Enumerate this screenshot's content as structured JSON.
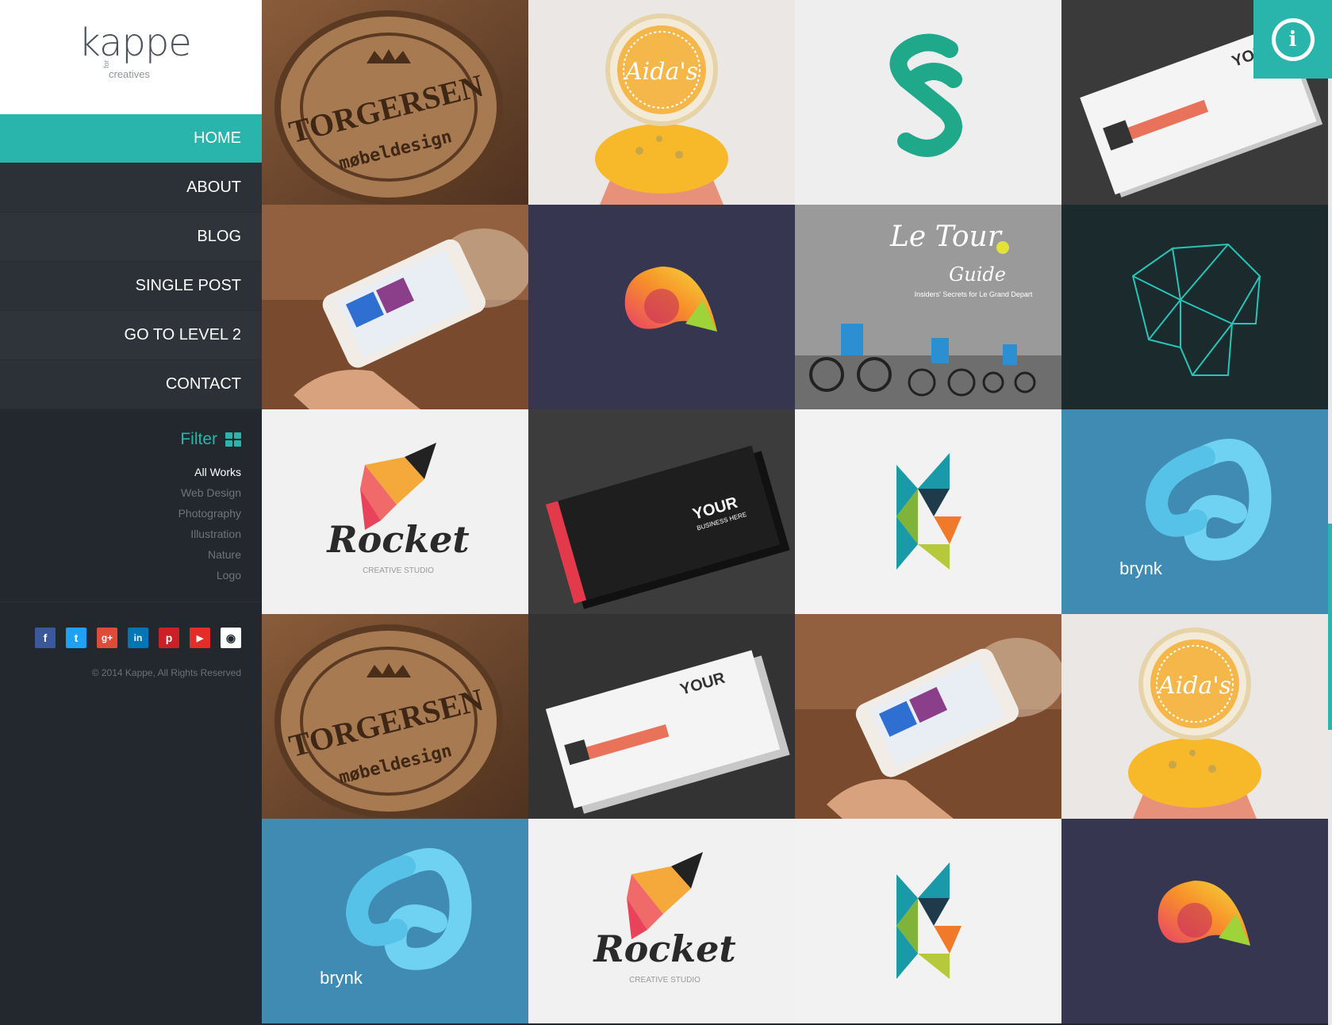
{
  "brand": {
    "logo_main": "kappe",
    "logo_for": "for",
    "logo_sub": "creatives"
  },
  "nav": {
    "items": [
      {
        "label": "HOME",
        "active": true
      },
      {
        "label": "ABOUT",
        "active": false
      },
      {
        "label": "BLOG",
        "active": false
      },
      {
        "label": "SINGLE POST",
        "active": false
      },
      {
        "label": "GO TO LEVEL 2",
        "active": false
      },
      {
        "label": "CONTACT",
        "active": false
      }
    ]
  },
  "filter": {
    "title": "Filter",
    "icon": "grid-icon",
    "options": [
      {
        "label": "All Works",
        "active": true
      },
      {
        "label": "Web Design",
        "active": false
      },
      {
        "label": "Photography",
        "active": false
      },
      {
        "label": "Illustration",
        "active": false
      },
      {
        "label": "Nature",
        "active": false
      },
      {
        "label": "Logo",
        "active": false
      }
    ]
  },
  "social": [
    {
      "name": "facebook-icon",
      "glyph": "f",
      "color": "#3b5998"
    },
    {
      "name": "twitter-icon",
      "glyph": "t",
      "color": "#1da1f2"
    },
    {
      "name": "google-plus-icon",
      "glyph": "g+",
      "color": "#dd4b39"
    },
    {
      "name": "linkedin-icon",
      "glyph": "in",
      "color": "#0077b5"
    },
    {
      "name": "pinterest-icon",
      "glyph": "p",
      "color": "#cb2027"
    },
    {
      "name": "youtube-icon",
      "glyph": "▶",
      "color": "#e52d27"
    },
    {
      "name": "github-icon",
      "glyph": "◉",
      "color": "#ffffff"
    }
  ],
  "footer": {
    "copyright": "© 2014 Kappe, All Rights Reserved"
  },
  "gallery": {
    "texts": {
      "torgersen": "TORGERSEN",
      "mobeldesign": "møbeldesign",
      "aidas": "Aida's",
      "your": "YOUR",
      "business_here": "BUSINESS HERE",
      "le_tour": "Le Tour",
      "guide": "Guide",
      "tour_sub": "Insiders' Secrets for Le Grand Depart",
      "rocket": "Rocket",
      "creative_studio": "CREATIVE STUDIO",
      "brynk": "brynk"
    }
  },
  "info_button": {
    "glyph": "i"
  },
  "colors": {
    "accent": "#29b4ac",
    "sidebar_bg": "#22282d",
    "nav_bg": "#2b3137"
  }
}
